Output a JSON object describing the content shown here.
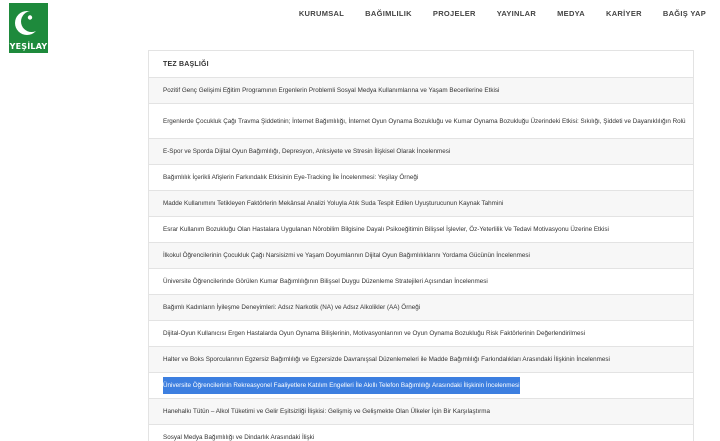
{
  "brand": {
    "logo_text": "YEŞİLAY",
    "color": "#1e8a3c"
  },
  "nav": {
    "items": [
      "KURUMSAL",
      "BAĞIMLILIK",
      "PROJELER",
      "YAYINLAR",
      "MEDYA",
      "KARİYER",
      "BAĞIŞ YAP"
    ]
  },
  "table": {
    "header": "TEZ BAŞLIĞI",
    "selected_row_index": 12,
    "selection_color": "#3d7fe0",
    "rows": [
      "Pozitif Genç Gelişimi Eğitim Programının Ergenlerin Problemli Sosyal Medya Kullanımlarına ve Yaşam Becerilerine Etkisi",
      "Ergenlerde Çocukluk Çağı Travma Şiddetinin; İnternet Bağımlılığı, İnternet Oyun Oynama Bozukluğu ve Kumar Oynama Bozukluğu Üzerindeki Etkisi: Sıkılığı, Şiddeti ve Dayanıklılığın Rolü",
      "E-Spor ve Sporda Dijital Oyun Bağımlılığı, Depresyon, Anksiyete ve Stresin İlişkisel Olarak İncelenmesi",
      "Bağımlılık İçerikli Afişlerin Farkındalık Etkisinin Eye-Tracking İle İncelenmesi: Yeşilay Örneği",
      "Madde Kullanımını Tetikleyen Faktörlerin Mekânsal Analizi Yoluyla Atık Suda Tespit Edilen Uyuşturucunun Kaynak Tahmini",
      "Esrar Kullanım Bozukluğu Olan Hastalara Uygulanan Nörobilim Bilgisine Dayalı Psikoeğitimin Bilişsel İşlevler, Öz-Yeterlilik Ve Tedavi Motivasyonu Üzerine Etkisi",
      "İlkokul Öğrencilerinin Çocukluk Çağı Narsisizmi ve Yaşam Doyumlarının Dijital Oyun Bağımlılıklarını Yordama Gücünün İncelenmesi",
      "Üniversite Öğrencilerinde Görülen Kumar Bağımlılığının Bilişsel Duygu Düzenleme Stratejileri Açısından İncelenmesi",
      "Bağımlı Kadınların İyileşme Deneyimleri: Adsız Narkotik (NA) ve Adsız Alkolikler (AA) Örneği",
      "Dijital-Oyun Kullanıcısı Ergen Hastalarda Oyun Oynama Bilişlerinin, Motivasyonlarının ve Oyun Oynama Bozukluğu Risk Faktörlerinin Değerlendirilmesi",
      "Halter ve Boks Sporcularının Egzersiz Bağımlılığı ve Egzersizde Davranışsal Düzenlemeleri ile Madde Bağımlılığı Farkındalıkları Arasındaki İlişkinin İncelenmesi",
      "Üniversite Öğrencilerinin Rekreasyonel Faaliyetlere Katılım Engelleri İle Akıllı Telefon Bağımlılığı Arasındaki İlişkinin İncelenmesi",
      "Hanehalkı Tütün – Alkol Tüketimi ve Gelir Eşitsizliği İlişkisi: Gelişmiş ve Gelişmekte Olan Ülkeler İçin Bir Karşılaştırma",
      "Sosyal Medya Bağımlılığı ve Dindarlık Arasındaki İlişki"
    ]
  }
}
